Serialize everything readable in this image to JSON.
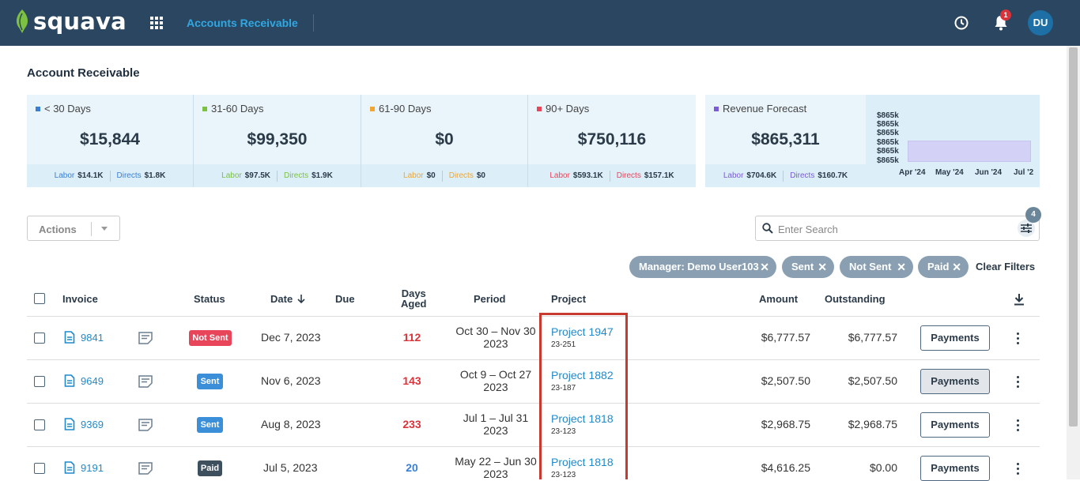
{
  "header": {
    "brand": "squava",
    "app_title": "Accounts Receivable",
    "notification_count": "1",
    "user_initials": "DU"
  },
  "page": {
    "title": "Account Receivable"
  },
  "aging_cards": [
    {
      "label": "< 30 Days",
      "color": "#3b7fd4",
      "amount": "$15,844",
      "labor_label": "Labor",
      "labor_value": "$14.1K",
      "directs_label": "Directs",
      "directs_value": "$1.8K",
      "accent": "#3b7fd4"
    },
    {
      "label": "31-60 Days",
      "color": "#7cc142",
      "amount": "$99,350",
      "labor_label": "Labor",
      "labor_value": "$97.5K",
      "directs_label": "Directs",
      "directs_value": "$1.9K",
      "accent": "#7cc142"
    },
    {
      "label": "61-90 Days",
      "color": "#f0a630",
      "amount": "$0",
      "labor_label": "Labor",
      "labor_value": "$0",
      "directs_label": "Directs",
      "directs_value": "$0",
      "accent": "#f0a630"
    },
    {
      "label": "90+ Days",
      "color": "#e8455a",
      "amount": "$750,116",
      "labor_label": "Labor",
      "labor_value": "$593.1K",
      "directs_label": "Directs",
      "directs_value": "$157.1K",
      "accent": "#e8455a"
    },
    {
      "label": "Revenue Forecast",
      "color": "#7b5cd6",
      "amount": "$865,311",
      "labor_label": "Labor",
      "labor_value": "$704.6K",
      "directs_label": "Directs",
      "directs_value": "$160.7K",
      "accent": "#7b5cd6"
    }
  ],
  "forecast_chart": {
    "y_ticks": [
      "$865k",
      "$865k",
      "$865k",
      "$865k",
      "$865k",
      "$865k"
    ],
    "x_ticks": [
      "Apr '24",
      "May '24",
      "Jun '24",
      "Jul '2"
    ]
  },
  "toolbar": {
    "actions_label": "Actions",
    "search_placeholder": "Enter Search",
    "filter_count": "4",
    "chips": [
      "Manager: Demo User103",
      "Sent",
      "Not Sent",
      "Paid"
    ],
    "clear_filters": "Clear Filters"
  },
  "table": {
    "headers": {
      "invoice": "Invoice",
      "status": "Status",
      "date": "Date",
      "due": "Due",
      "days_aged_1": "Days",
      "days_aged_2": "Aged",
      "period": "Period",
      "project": "Project",
      "amount": "Amount",
      "outstanding": "Outstanding"
    },
    "payments_label": "Payments",
    "rows": [
      {
        "invoice": "9841",
        "status": "Not Sent",
        "status_color": "#e8455a",
        "date": "Dec 7, 2023",
        "days": "112",
        "days_color": "#d9343b",
        "period_1": "Oct 30 – Nov 30",
        "period_2": "2023",
        "project": "Project 1947",
        "project_code": "23-251",
        "amount": "$6,777.57",
        "outstanding": "$6,777.57"
      },
      {
        "invoice": "9649",
        "status": "Sent",
        "status_color": "#3b8fd9",
        "date": "Nov 6, 2023",
        "days": "143",
        "days_color": "#d9343b",
        "period_1": "Oct 9 – Oct 27",
        "period_2": "2023",
        "project": "Project 1882",
        "project_code": "23-187",
        "amount": "$2,507.50",
        "outstanding": "$2,507.50"
      },
      {
        "invoice": "9369",
        "status": "Sent",
        "status_color": "#3b8fd9",
        "date": "Aug 8, 2023",
        "days": "233",
        "days_color": "#d9343b",
        "period_1": "Jul 1 – Jul 31",
        "period_2": "2023",
        "project": "Project 1818",
        "project_code": "23-123",
        "amount": "$2,968.75",
        "outstanding": "$2,968.75"
      },
      {
        "invoice": "9191",
        "status": "Paid",
        "status_color": "#3e4f5e",
        "date": "Jul 5, 2023",
        "days": "20",
        "days_color": "#3b7fd4",
        "period_1": "May 22 – Jun 30",
        "period_2": "2023",
        "project": "Project 1818",
        "project_code": "23-123",
        "amount": "$4,616.25",
        "outstanding": "$0.00"
      }
    ]
  }
}
